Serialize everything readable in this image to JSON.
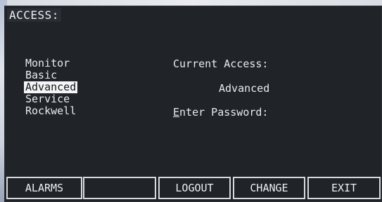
{
  "screen": {
    "title": "ACCESS:"
  },
  "access_levels": {
    "items": [
      {
        "label": "Monitor",
        "selected": false
      },
      {
        "label": "Basic",
        "selected": false
      },
      {
        "label": "Advanced",
        "selected": true
      },
      {
        "label": "Service",
        "selected": false
      },
      {
        "label": "Rockwell",
        "selected": false
      }
    ]
  },
  "current_access": {
    "label": "Current Access:",
    "value": "Advanced"
  },
  "password": {
    "hotkey": "E",
    "label_rest": "nter Password:"
  },
  "softkeys": [
    {
      "label": "ALARMS"
    },
    {
      "label": ""
    },
    {
      "label": "LOGOUT"
    },
    {
      "label": "CHANGE"
    },
    {
      "label": "EXIT"
    }
  ],
  "colors": {
    "screen_background": "#202328",
    "text": "#e8ebee",
    "selection_background": "#f3f4f5",
    "softkey_border": "#d6d9dd"
  }
}
